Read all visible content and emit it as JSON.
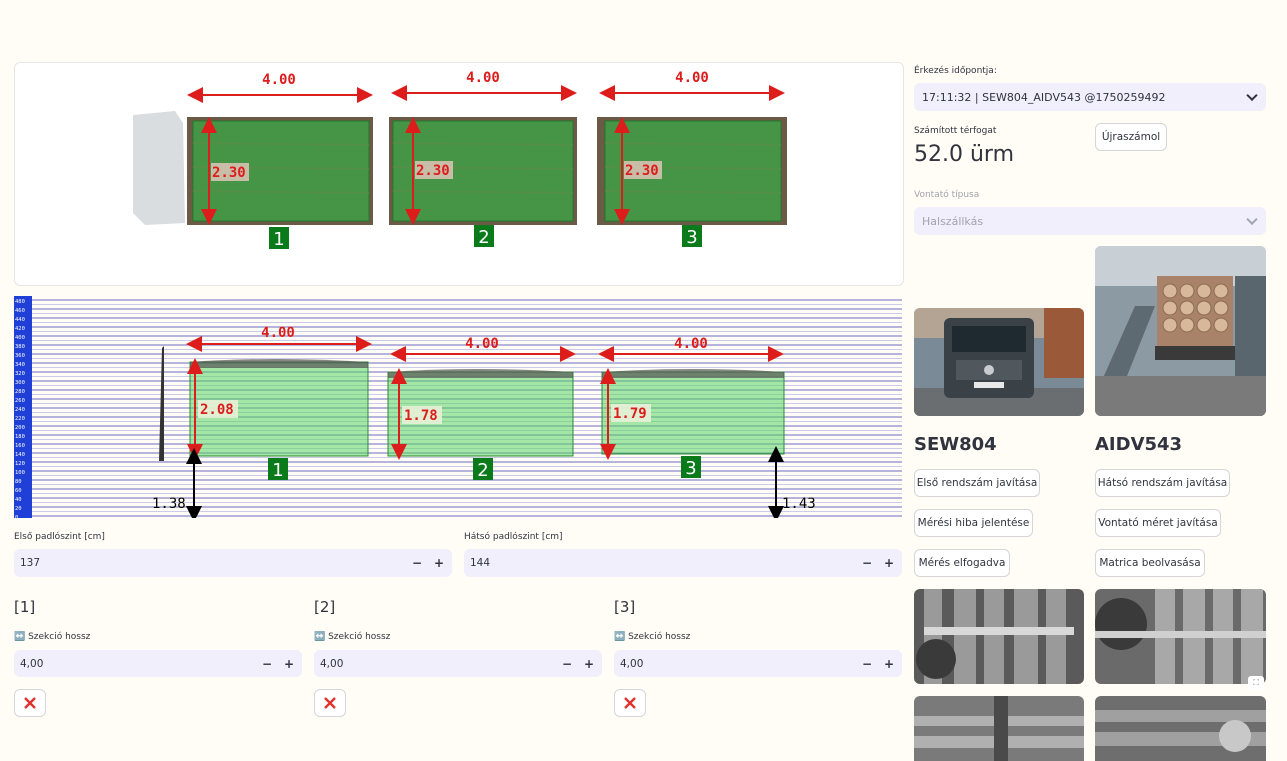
{
  "diagram": {
    "top_sections": [
      {
        "length": "4.00",
        "height": "2.30",
        "number": "1"
      },
      {
        "length": "4.00",
        "height": "2.30",
        "number": "2"
      },
      {
        "length": "4.00",
        "height": "2.30",
        "number": "3"
      }
    ],
    "side_sections": [
      {
        "length": "4.00",
        "height": "2.08",
        "number": "1"
      },
      {
        "length": "4.00",
        "height": "1.78",
        "number": "2"
      },
      {
        "length": "4.00",
        "height": "1.79",
        "number": "3"
      }
    ],
    "floor_front": "1.38",
    "floor_rear": "1.43",
    "scale_ticks": [
      "480",
      "460",
      "440",
      "420",
      "400",
      "380",
      "360",
      "340",
      "320",
      "300",
      "280",
      "260",
      "240",
      "220",
      "200",
      "180",
      "160",
      "140",
      "120",
      "100",
      "80",
      "60",
      "40",
      "20",
      "0"
    ]
  },
  "floor": {
    "front_label": "Első padlószint [cm]",
    "front_value": "137",
    "rear_label": "Hátsó padlószint [cm]",
    "rear_value": "144"
  },
  "sections": [
    {
      "title": "[1]",
      "label": "↔️ Szekció hossz",
      "value": "4,00"
    },
    {
      "title": "[2]",
      "label": "↔️ Szekció hossz",
      "value": "4,00"
    },
    {
      "title": "[3]",
      "label": "↔️ Szekció hossz",
      "value": "4,00"
    }
  ],
  "right": {
    "arrival_label": "Érkezés időpontja:",
    "arrival_value": "17:11:32 | SEW804_AIDV543 @1750259492",
    "volume_label": "Számított térfogat",
    "volume_value": "52.0 ürm",
    "recalc_button": "Újraszámol",
    "tractor_label": "Vontató típusa",
    "tractor_value": "Halszállkás",
    "front_plate": "SEW804",
    "rear_plate": "AIDV543",
    "buttons_left": [
      "Első rendszám javítása",
      "Mérési hiba jelentése",
      "Mérés elfogadva"
    ],
    "buttons_right": [
      "Hátsó rendszám javítása",
      "Vontató méret javítása",
      "Matrica beolvasása"
    ]
  },
  "colors": {
    "accent_green": "#2e9e3a",
    "measure_red": "#dd1c1c",
    "input_bg": "#f0effb"
  }
}
